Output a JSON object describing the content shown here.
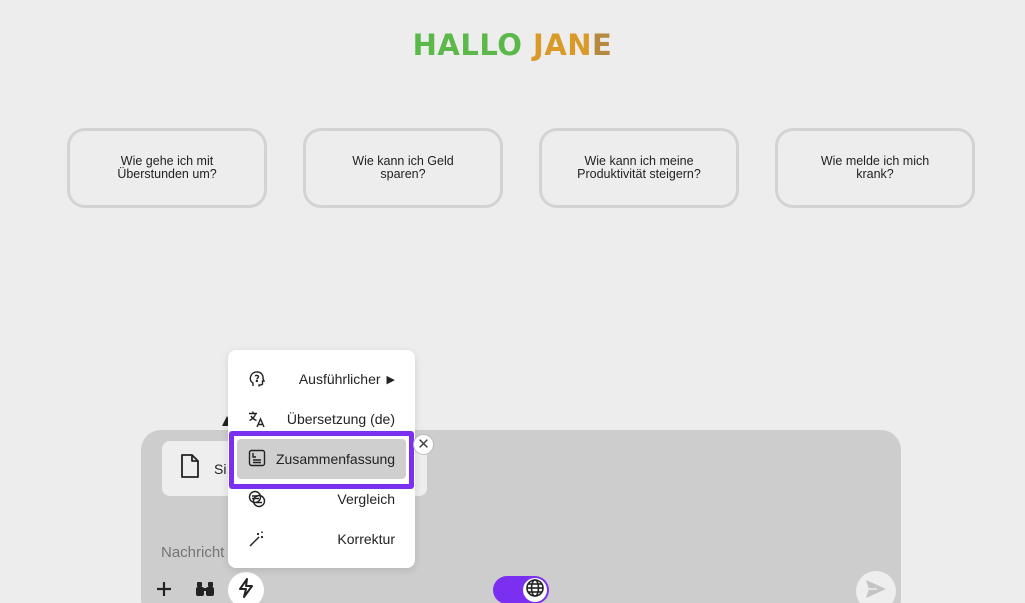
{
  "greeting": {
    "part1": "HALLO ",
    "part2": "JAN",
    "part3": "E"
  },
  "suggestions": [
    "Wie gehe ich mit Überstunden um?",
    "Wie kann ich Geld sparen?",
    "Wie kann ich meine Produktivität steigern?",
    "Wie melde ich mich krank?"
  ],
  "attachment": {
    "name_visible": "Si"
  },
  "composer": {
    "placeholder": "Nachricht"
  },
  "menu": {
    "items": [
      {
        "label": "Ausführlicher",
        "icon": "head-question-icon",
        "has_submenu": true
      },
      {
        "label": "Übersetzung (de)",
        "icon": "translate-icon"
      },
      {
        "label": "Zusammenfassung",
        "icon": "summary-icon",
        "selected": true
      },
      {
        "label": "Vergleich",
        "icon": "compare-icon"
      },
      {
        "label": "Korrektur",
        "icon": "magic-wand-icon"
      }
    ]
  },
  "icons": {
    "add": "plus-icon",
    "search": "binoculars-icon",
    "actions": "lightning-bolt-icon",
    "web": "globe-icon",
    "send": "send-icon",
    "close": "close-icon",
    "file": "document-icon"
  },
  "colors": {
    "accent": "#7b2ff0",
    "greeting_green": "#5bb94a",
    "greeting_orange": "#d99a2a"
  }
}
